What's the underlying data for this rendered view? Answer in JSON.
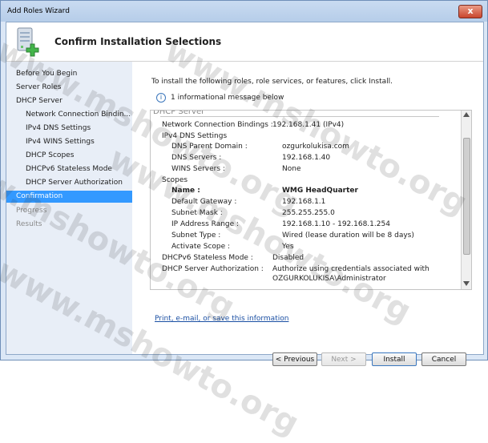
{
  "window": {
    "title": "Add Roles Wizard",
    "close_label": "x"
  },
  "header": {
    "title": "Confirm Installation Selections"
  },
  "nav": {
    "items": [
      {
        "label": "Before You Begin"
      },
      {
        "label": "Server Roles"
      },
      {
        "label": "DHCP Server"
      },
      {
        "label": "Network Connection Bindin..."
      },
      {
        "label": "IPv4 DNS Settings"
      },
      {
        "label": "IPv4 WINS Settings"
      },
      {
        "label": "DHCP Scopes"
      },
      {
        "label": "DHCPv6 Stateless Mode"
      },
      {
        "label": "DHCP Server Authorization"
      },
      {
        "label": "Confirmation"
      },
      {
        "label": "Progress"
      },
      {
        "label": "Results"
      }
    ]
  },
  "content": {
    "intro": "To install the following roles, role services, or features, click Install.",
    "info": "1 informational message below",
    "section": "DHCP Server",
    "rows": [
      {
        "label": "Network Connection Bindings :",
        "value": "192.168.1.41 (IPv4)"
      },
      {
        "label": "IPv4 DNS Settings",
        "value": ""
      },
      {
        "label": "DNS Parent Domain :",
        "value": "ozgurkolukisa.com"
      },
      {
        "label": "DNS Servers :",
        "value": "192.168.1.40"
      },
      {
        "label": "WINS Servers :",
        "value": "None"
      },
      {
        "label": "Scopes",
        "value": ""
      },
      {
        "label": "Name :",
        "value": "WMG HeadQuarter"
      },
      {
        "label": "Default Gateway :",
        "value": "192.168.1.1"
      },
      {
        "label": "Subnet Mask :",
        "value": "255.255.255.0"
      },
      {
        "label": "IP Address Range :",
        "value": "192.168.1.10 - 192.168.1.254"
      },
      {
        "label": "Subnet Type :",
        "value": "Wired (lease duration will be 8 days)"
      },
      {
        "label": "Activate Scope :",
        "value": "Yes"
      },
      {
        "label": "DHCPv6 Stateless Mode :",
        "value": "Disabled"
      },
      {
        "label": "DHCP Server Authorization :",
        "value": "Authorize using credentials associated with"
      },
      {
        "label": "",
        "value": "OZGURKOLUKISA\\Administrator"
      }
    ],
    "link": "Print, e-mail, or save this information"
  },
  "buttons": {
    "previous": "< Previous",
    "next": "Next >",
    "install": "Install",
    "cancel": "Cancel"
  },
  "watermark": "www.mshowto.org"
}
